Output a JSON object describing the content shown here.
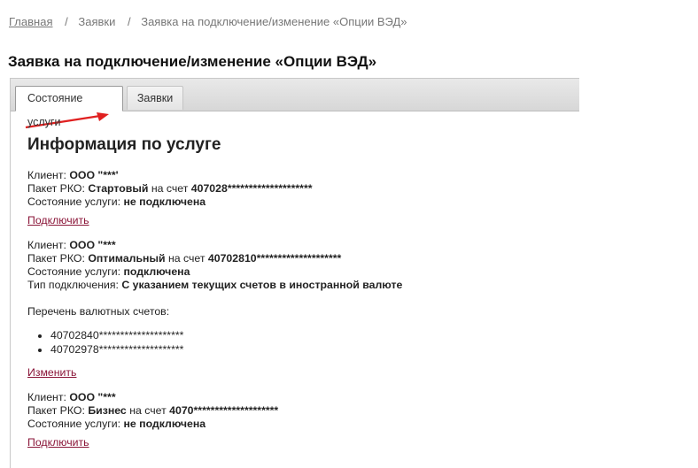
{
  "breadcrumb": {
    "home": "Главная",
    "requests": "Заявки",
    "current": "Заявка на подключение/изменение «Опции ВЭД»",
    "separator": "/"
  },
  "page_title": "Заявка на подключение/изменение «Опции ВЭД»",
  "tabs": [
    {
      "label": "Состояние услуги",
      "active": true
    },
    {
      "label": "Заявки",
      "active": false
    }
  ],
  "section_title": "Информация по услуге",
  "labels": {
    "client": "Клиент:",
    "package": "Пакет РКО:",
    "on_account": "на счет",
    "status": "Состояние услуги:",
    "connection_type": "Тип подключения:",
    "accounts_list": "Перечень валютных счетов:"
  },
  "services": [
    {
      "client": "ООО \"***'",
      "package": "Стартовый",
      "account": "407028********************",
      "status": "не подключена",
      "action": "Подключить"
    },
    {
      "client": "ООО \"***",
      "package": "Оптимальный",
      "account": "40702810********************",
      "status": "подключена",
      "connection_type": "С указанием текущих счетов в иностранной валюте",
      "currency_accounts": [
        "40702840********************",
        "40702978********************"
      ],
      "action": "Изменить"
    },
    {
      "client": "ООО \"***",
      "package": "Бизнес",
      "account": "4070********************",
      "status": "не подключена",
      "action": "Подключить"
    }
  ],
  "colors": {
    "link": "#8a1538",
    "annotation_arrow": "#e02020"
  }
}
